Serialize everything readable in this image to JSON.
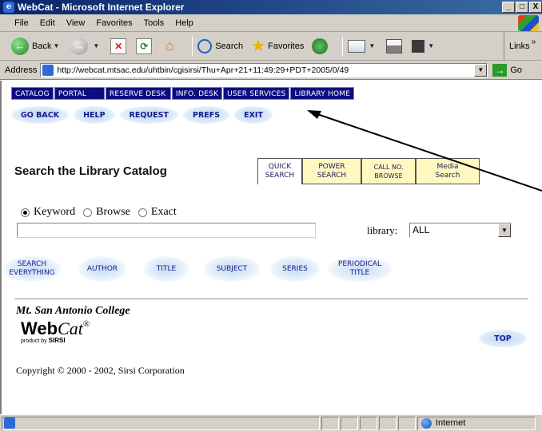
{
  "window": {
    "title": "WebCat - Microsoft Internet Explorer",
    "buttons": [
      "_",
      "□",
      "X"
    ]
  },
  "menubar": [
    "File",
    "Edit",
    "View",
    "Favorites",
    "Tools",
    "Help"
  ],
  "toolbar": {
    "back": "Back",
    "search": "Search",
    "favorites": "Favorites",
    "links": "Links"
  },
  "address": {
    "label": "Address",
    "url": "http://webcat.mtsac.edu/uhtbin/cgisirsi/Thu+Apr+21+11:49:29+PDT+2005/0/49",
    "go": "Go"
  },
  "topnav": [
    "CATALOG",
    "PORTAL",
    "RESERVE DESK",
    "INFO. DESK",
    "USER SERVICES",
    "LIBRARY HOME"
  ],
  "subnav": [
    "GO BACK",
    "HELP",
    "REQUEST",
    "PREFS",
    "EXIT"
  ],
  "heading": "Search the Library Catalog",
  "tabs": [
    {
      "line1": "QUICK",
      "line2": "SEARCH"
    },
    {
      "line1": "POWER",
      "line2": "SEARCH"
    },
    {
      "line1": "CALL NO.",
      "line2": "BROWSE"
    },
    {
      "line1": "Media",
      "line2": "Search"
    }
  ],
  "search_types": {
    "selected": "Keyword",
    "options": [
      "Keyword",
      "Browse",
      "Exact"
    ]
  },
  "search": {
    "value": "",
    "library_label": "library:",
    "library_value": "ALL"
  },
  "fields": [
    {
      "line1": "SEARCH",
      "line2": "EVERYTHING"
    },
    {
      "line1": "AUTHOR",
      "line2": ""
    },
    {
      "line1": "TITLE",
      "line2": ""
    },
    {
      "line1": "SUBJECT",
      "line2": ""
    },
    {
      "line1": "SERIES",
      "line2": ""
    },
    {
      "line1": "PERIODICAL",
      "line2": "TITLE"
    }
  ],
  "footer": {
    "college": "Mt. San Antonio College",
    "webcat_bold": "Web",
    "webcat_italic": "Cat",
    "reg": "®",
    "product_by": "product by",
    "sirsi": "SIRSI",
    "top": "TOP",
    "copyright": "Copyright © 2000 - 2002, Sirsi Corporation"
  },
  "statusbar": {
    "zone": "Internet"
  }
}
